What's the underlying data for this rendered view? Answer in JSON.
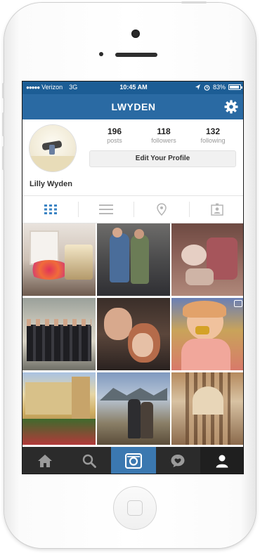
{
  "status_bar": {
    "carrier": "Verizon",
    "network": "3G",
    "time": "10:45 AM",
    "battery": "83%"
  },
  "nav": {
    "title": "LWYDEN"
  },
  "profile": {
    "name": "Lilly Wyden",
    "stats": [
      {
        "value": "196",
        "label": "posts"
      },
      {
        "value": "118",
        "label": "followers"
      },
      {
        "value": "132",
        "label": "following"
      }
    ],
    "edit_label": "Edit Your Profile"
  },
  "view_tabs": [
    "grid-icon",
    "list-icon",
    "location-pin-icon",
    "tagged-photos-icon"
  ],
  "bottom_tabs": [
    "home-icon",
    "search-icon",
    "camera-icon",
    "activity-icon",
    "profile-icon"
  ],
  "colors": {
    "header_blue": "#2a6aa3",
    "status_blue": "#1c5d95",
    "active_tab_blue": "#3b78b0",
    "tabbar_dark": "#2b2b2b"
  }
}
